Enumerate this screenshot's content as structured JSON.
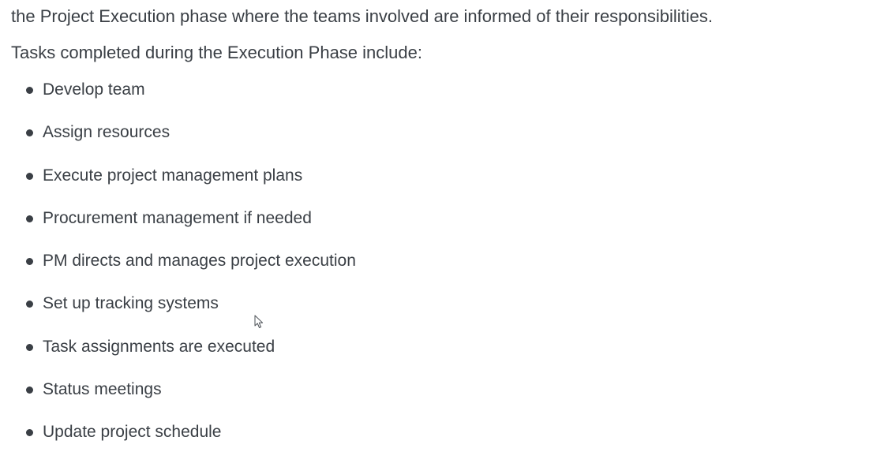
{
  "document": {
    "intro_line": "the Project Execution phase where the teams involved are informed of their responsibilities.",
    "lead_text": "Tasks completed during the Execution Phase include:",
    "tasks": [
      {
        "label": "Develop team"
      },
      {
        "label": "Assign resources"
      },
      {
        "label": "Execute project management plans"
      },
      {
        "label": "Procurement management if needed"
      },
      {
        "label": "PM directs and manages project execution"
      },
      {
        "label": "Set up tracking systems"
      },
      {
        "label": "Task assignments are executed"
      },
      {
        "label": "Status meetings"
      },
      {
        "label": "Update project schedule"
      }
    ]
  },
  "colors": {
    "text": "#3a3f45",
    "background": "#ffffff"
  },
  "icons": {
    "cursor": "mouse-pointer-icon",
    "bullet": "bullet-dot-icon"
  }
}
